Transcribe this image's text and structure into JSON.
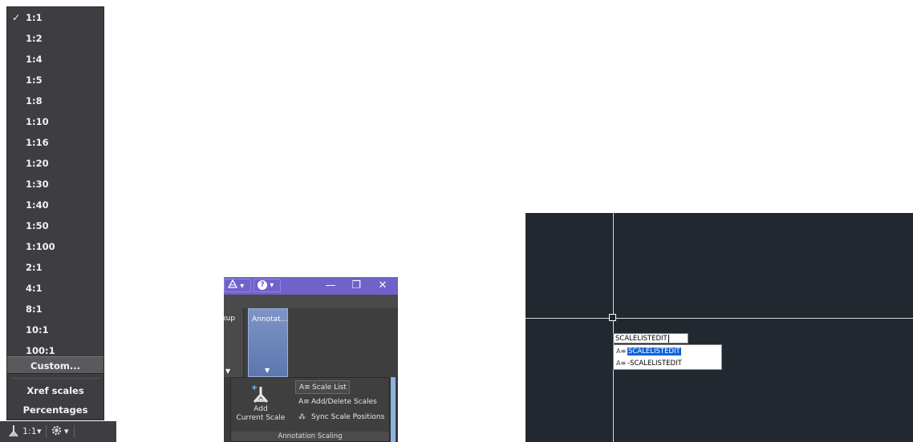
{
  "scale_menu": {
    "items": [
      {
        "label": "1:1",
        "checked": true
      },
      {
        "label": "1:2"
      },
      {
        "label": "1:4"
      },
      {
        "label": "1:5"
      },
      {
        "label": "1:8"
      },
      {
        "label": "1:10"
      },
      {
        "label": "1:16"
      },
      {
        "label": "1:20"
      },
      {
        "label": "1:30"
      },
      {
        "label": "1:40"
      },
      {
        "label": "1:50"
      },
      {
        "label": "1:100"
      },
      {
        "label": "2:1"
      },
      {
        "label": "4:1"
      },
      {
        "label": "8:1"
      },
      {
        "label": "10:1"
      },
      {
        "label": "100:1"
      }
    ],
    "check_mark": "✓",
    "custom_label": "Custom...",
    "xref_label": "Xref scales",
    "percent_label": "Percentages"
  },
  "status_bar": {
    "scale_value": "1:1",
    "dropdown_arrow": "▾",
    "gear_icon": "gear-icon"
  },
  "ribbon": {
    "title_colors": {
      "titlebar": "#6f62c9"
    },
    "help_label": "?",
    "minimize": "—",
    "restore": "❐",
    "close": "✕",
    "tab_left_label": "rkup",
    "tab_active_label": "Annotat...",
    "add_current_scale_line1": "Add",
    "add_current_scale_line2": "Current Scale",
    "scale_list_label": "Scale List",
    "add_delete_label": "Add/Delete Scales",
    "sync_label": "Sync Scale Positions",
    "panel_title": "Annotation Scaling"
  },
  "command": {
    "typed_text": "SCALELISTEDIT",
    "suggestions": [
      {
        "label": "SCALELISTEDIT",
        "selected": true
      },
      {
        "label": "-SCALELISTEDIT",
        "selected": false
      }
    ]
  }
}
